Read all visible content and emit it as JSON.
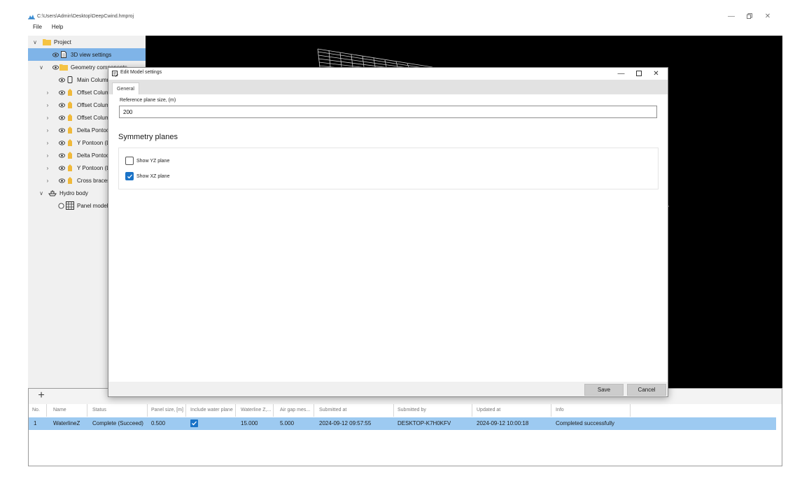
{
  "app": {
    "title": "C:\\Users\\Admin\\Desktop\\DeepCwind.hmproj",
    "menu": [
      "File",
      "Help"
    ]
  },
  "tree": {
    "items": [
      {
        "label": "Project",
        "icon": "folder-icon"
      },
      {
        "label": "3D view settings",
        "icon": "document-icon"
      },
      {
        "label": "Geometry components",
        "icon": "folder-icon"
      },
      {
        "label": "Main Column",
        "icon": "cylinder-icon"
      },
      {
        "label": "Offset Column",
        "icon": "component-icon"
      },
      {
        "label": "Offset Column",
        "icon": "component-icon"
      },
      {
        "label": "Offset Column",
        "icon": "component-icon"
      },
      {
        "label": "Delta Pontoon",
        "icon": "component-icon"
      },
      {
        "label": "Y Pontoon (L",
        "icon": "component-icon"
      },
      {
        "label": "Delta Pontoon",
        "icon": "component-icon"
      },
      {
        "label": "Y Pontoon (L",
        "icon": "component-icon"
      },
      {
        "label": "Cross braces",
        "icon": "component-icon"
      },
      {
        "label": "Hydro body",
        "icon": "ship-icon"
      },
      {
        "label": "Panel model",
        "icon": "grid-icon"
      }
    ]
  },
  "table": {
    "columns": [
      "No.",
      "Name",
      "Status",
      "Panel size, [m]",
      "Include water plane",
      "Waterline Z,...",
      "Air gap mes...",
      "Submitted at",
      "Submitted by",
      "Updated at",
      "Info"
    ],
    "rows": [
      {
        "no": "1",
        "name": "WaterlineZ",
        "status": "Complete (Succeed)",
        "panel_size": "0.500",
        "include_water_plane": true,
        "waterline_z": "15.000",
        "air_gap": "5.000",
        "submitted_at": "2024-09-12 09:57:55",
        "submitted_by": "DESKTOP-K7H0KFV",
        "updated_at": "2024-09-12 10:00:18",
        "info": "Completed successfully"
      }
    ]
  },
  "dialog": {
    "title": "Edit Model settings",
    "tab": "General",
    "reference_label": "Reference plane size, (m)",
    "reference_value": "200",
    "section_title": "Symmetry planes",
    "show_yz": {
      "label": "Show YZ plane",
      "checked": false
    },
    "show_xz": {
      "label": "Show XZ plane",
      "checked": true
    },
    "save_label": "Save",
    "cancel_label": "Cancel"
  },
  "colors": {
    "selection": "#7fb4e8",
    "row_selection": "#9dcaf1",
    "accent": "#1a73c7",
    "viewport_bg": "#000000"
  }
}
